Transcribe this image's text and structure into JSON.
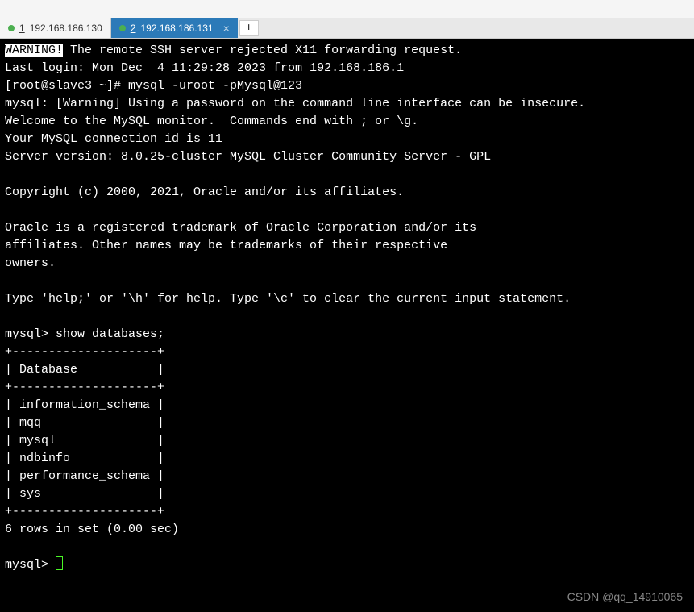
{
  "tabs": {
    "tab1": {
      "number": "1",
      "ip": "192.168.186.130"
    },
    "tab2": {
      "number": "2",
      "ip": "192.168.186.131"
    },
    "add_label": "+"
  },
  "terminal": {
    "warning_label": "WARNING!",
    "warning_text": " The remote SSH server rejected X11 forwarding request.",
    "last_login": "Last login: Mon Dec  4 11:29:28 2023 from 192.168.186.1",
    "prompt_line": "[root@slave3 ~]# mysql -uroot -pMysql@123",
    "warn_password": "mysql: [Warning] Using a password on the command line interface can be insecure.",
    "welcome": "Welcome to the MySQL monitor.  Commands end with ; or \\g.",
    "conn_id": "Your MySQL connection id is 11",
    "server_version": "Server version: 8.0.25-cluster MySQL Cluster Community Server - GPL",
    "copyright": "Copyright (c) 2000, 2021, Oracle and/or its affiliates.",
    "trademark1": "Oracle is a registered trademark of Oracle Corporation and/or its",
    "trademark2": "affiliates. Other names may be trademarks of their respective",
    "trademark3": "owners.",
    "help_line": "Type 'help;' or '\\h' for help. Type '\\c' to clear the current input statement.",
    "mysql_prompt1": "mysql> show databases;",
    "table_top": "+--------------------+",
    "table_header": "| Database           |",
    "table_sep": "+--------------------+",
    "row1": "| information_schema |",
    "row2": "| mqq                |",
    "row3": "| mysql              |",
    "row4": "| ndbinfo            |",
    "row5": "| performance_schema |",
    "row6": "| sys                |",
    "table_bottom": "+--------------------+",
    "rows_summary": "6 rows in set (0.00 sec)",
    "mysql_prompt2": "mysql> "
  },
  "watermark": "CSDN @qq_14910065"
}
